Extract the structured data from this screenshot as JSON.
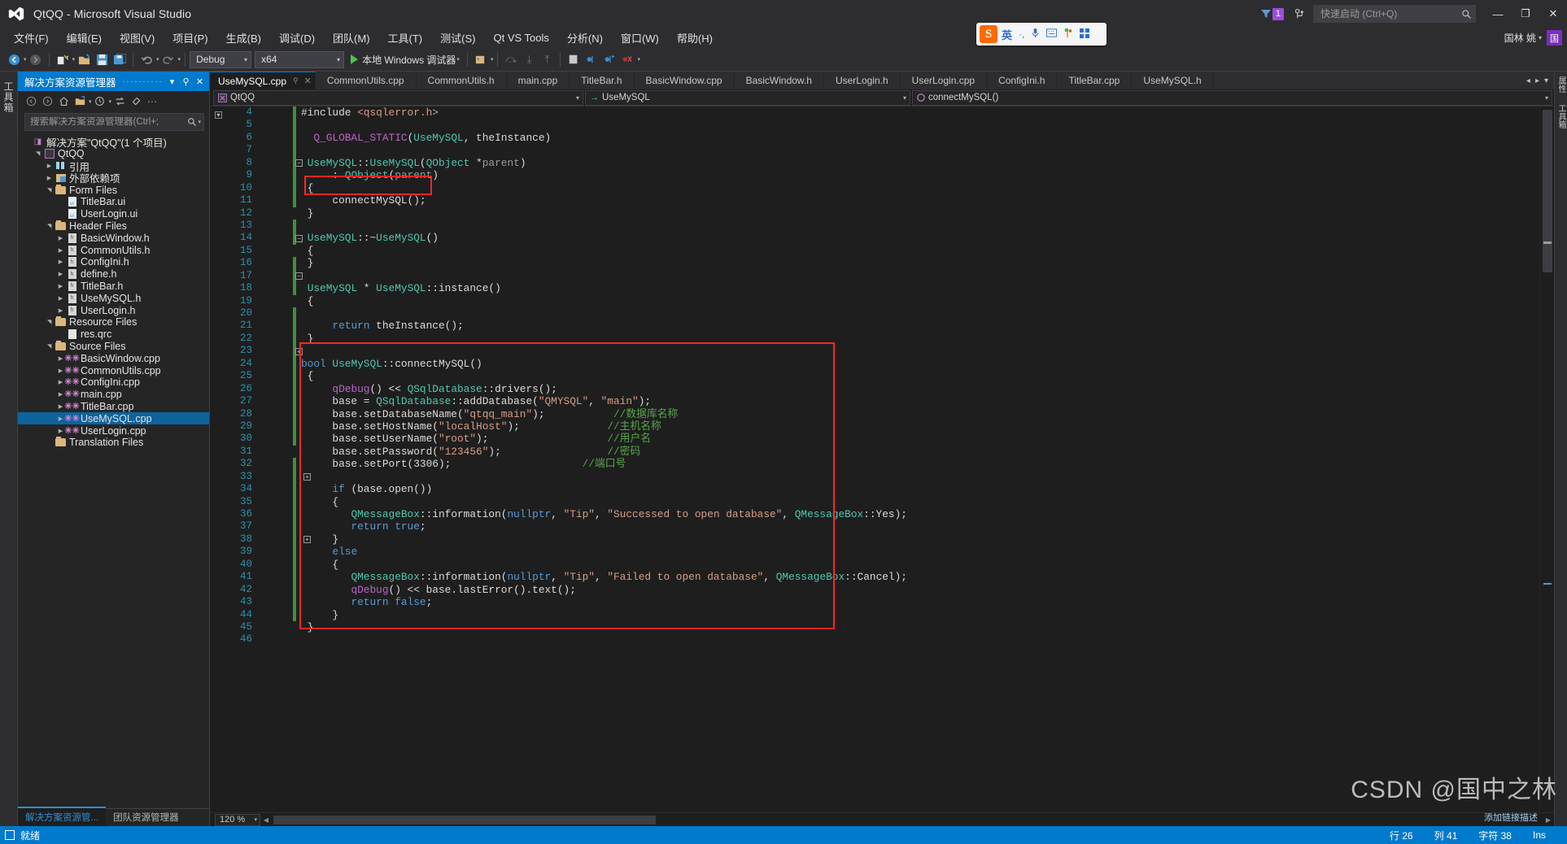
{
  "window": {
    "title": "QtQQ - Microsoft Visual Studio",
    "minimize": "—",
    "maximize": "❐",
    "close": "✕",
    "filter_badge": "1"
  },
  "quick_launch": {
    "placeholder": "快速启动 (Ctrl+Q)",
    "value": ""
  },
  "user": {
    "name": "国林 姚",
    "caret": "▾",
    "avatar_initial": "国"
  },
  "ime": {
    "logo": "S",
    "lang": "英",
    "punct": "·,",
    "mic": "🎤",
    "keyboard": "▦",
    "tools": "✿",
    "apps": "▩"
  },
  "menubar": [
    {
      "label": "文件(F)"
    },
    {
      "label": "编辑(E)"
    },
    {
      "label": "视图(V)"
    },
    {
      "label": "项目(P)"
    },
    {
      "label": "生成(B)"
    },
    {
      "label": "调试(D)"
    },
    {
      "label": "团队(M)"
    },
    {
      "label": "工具(T)"
    },
    {
      "label": "测试(S)"
    },
    {
      "label": "Qt VS Tools"
    },
    {
      "label": "分析(N)"
    },
    {
      "label": "窗口(W)"
    },
    {
      "label": "帮助(H)"
    }
  ],
  "toolbar": {
    "nav_back": "◉",
    "nav_forward": "◉",
    "new_item": "✹",
    "open": "↷",
    "save": "💾",
    "save_all": "🗐",
    "undo": "↶",
    "redo": "↷",
    "config_combo": {
      "value": "Debug",
      "caret": "▾"
    },
    "platform_combo": {
      "value": "x64",
      "caret": "▾"
    },
    "run_label": "本地 Windows 调试器",
    "run_caret": "▾"
  },
  "solution_explorer": {
    "title": "解决方案资源管理器",
    "dots": "··········",
    "dropdown": "▾",
    "pin": "⚲",
    "close": "✕",
    "toolbar": [
      "◀",
      "▶",
      "⌂",
      "🗀",
      "▾",
      "◔",
      "▾",
      "⇆",
      "⛭",
      "»"
    ],
    "search_placeholder": "搜索解决方案资源管理器(Ctrl+;",
    "search_value": "",
    "tabs": [
      {
        "label": "解决方案资源管...",
        "active": true
      },
      {
        "label": "团队资源管理器",
        "active": false
      }
    ],
    "tree": [
      {
        "label": "解决方案\"QtQQ\"(1 个项目)",
        "indent": 0,
        "arrow": "",
        "icon": "solution-icon",
        "selected": false
      },
      {
        "label": "QtQQ",
        "indent": 1,
        "arrow": "open",
        "icon": "project-icon",
        "selected": false
      },
      {
        "label": "引用",
        "indent": 2,
        "arrow": "closed",
        "icon": "reference-icon",
        "selected": false
      },
      {
        "label": "外部依赖项",
        "indent": 2,
        "arrow": "closed",
        "icon": "external-icon",
        "selected": false
      },
      {
        "label": "Form Files",
        "indent": 2,
        "arrow": "open",
        "icon": "folder-icon",
        "selected": false
      },
      {
        "label": "TitleBar.ui",
        "indent": 3,
        "arrow": "",
        "icon": "ui-file-icon",
        "selected": false
      },
      {
        "label": "UserLogin.ui",
        "indent": 3,
        "arrow": "",
        "icon": "ui-file-icon",
        "selected": false
      },
      {
        "label": "Header Files",
        "indent": 2,
        "arrow": "open",
        "icon": "folder-icon",
        "selected": false
      },
      {
        "label": "BasicWindow.h",
        "indent": 3,
        "arrow": "closed",
        "icon": "h-file-icon",
        "selected": false
      },
      {
        "label": "CommonUtils.h",
        "indent": 3,
        "arrow": "closed",
        "icon": "h-file-icon",
        "selected": false
      },
      {
        "label": "ConfigIni.h",
        "indent": 3,
        "arrow": "closed",
        "icon": "h-file-icon",
        "selected": false
      },
      {
        "label": "define.h",
        "indent": 3,
        "arrow": "closed",
        "icon": "h-file-icon",
        "selected": false
      },
      {
        "label": "TitleBar.h",
        "indent": 3,
        "arrow": "closed",
        "icon": "h-file-icon",
        "selected": false
      },
      {
        "label": "UseMySQL.h",
        "indent": 3,
        "arrow": "closed",
        "icon": "h-file-icon",
        "selected": false
      },
      {
        "label": "UserLogin.h",
        "indent": 3,
        "arrow": "closed",
        "icon": "h-file-icon",
        "selected": false
      },
      {
        "label": "Resource Files",
        "indent": 2,
        "arrow": "open",
        "icon": "folder-icon",
        "selected": false
      },
      {
        "label": "res.qrc",
        "indent": 3,
        "arrow": "",
        "icon": "qrc-file-icon",
        "selected": false
      },
      {
        "label": "Source Files",
        "indent": 2,
        "arrow": "open",
        "icon": "folder-icon",
        "selected": false
      },
      {
        "label": "BasicWindow.cpp",
        "indent": 3,
        "arrow": "closed",
        "icon": "cpp-file-icon",
        "selected": false
      },
      {
        "label": "CommonUtils.cpp",
        "indent": 3,
        "arrow": "closed",
        "icon": "cpp-file-icon",
        "selected": false
      },
      {
        "label": "ConfigIni.cpp",
        "indent": 3,
        "arrow": "closed",
        "icon": "cpp-file-icon",
        "selected": false
      },
      {
        "label": "main.cpp",
        "indent": 3,
        "arrow": "closed",
        "icon": "cpp-file-icon",
        "selected": false
      },
      {
        "label": "TitleBar.cpp",
        "indent": 3,
        "arrow": "closed",
        "icon": "cpp-file-icon",
        "selected": false
      },
      {
        "label": "UseMySQL.cpp",
        "indent": 3,
        "arrow": "closed",
        "icon": "cpp-file-icon",
        "selected": true
      },
      {
        "label": "UserLogin.cpp",
        "indent": 3,
        "arrow": "closed",
        "icon": "cpp-file-icon",
        "selected": false
      },
      {
        "label": "Translation Files",
        "indent": 2,
        "arrow": "",
        "icon": "folder-icon",
        "selected": false
      }
    ]
  },
  "editor": {
    "tabs": [
      {
        "label": "UseMySQL.cpp",
        "active": true,
        "pin": "⚲",
        "close": "✕"
      },
      {
        "label": "CommonUtils.cpp",
        "active": false
      },
      {
        "label": "CommonUtils.h",
        "active": false
      },
      {
        "label": "main.cpp",
        "active": false
      },
      {
        "label": "TitleBar.h",
        "active": false
      },
      {
        "label": "BasicWindow.cpp",
        "active": false
      },
      {
        "label": "BasicWindow.h",
        "active": false
      },
      {
        "label": "UserLogin.h",
        "active": false
      },
      {
        "label": "UserLogin.cpp",
        "active": false
      },
      {
        "label": "ConfigIni.h",
        "active": false
      },
      {
        "label": "TitleBar.cpp",
        "active": false
      },
      {
        "label": "UseMySQL.h",
        "active": false
      }
    ],
    "tab_overflow": {
      "left": "◂",
      "right": "▸",
      "list": "▾"
    },
    "navbar": {
      "project": "QtQQ",
      "class": "UseMySQL",
      "member": "connectMySQL()",
      "caret": "▾"
    },
    "zoom": "120 %",
    "first_line": 4,
    "lines": [
      {
        "n": 4,
        "tokens": [
          {
            "t": "#include ",
            "c": "pl"
          },
          {
            "t": "<qsqlerror.h>",
            "c": "st"
          }
        ]
      },
      {
        "n": 5,
        "tokens": []
      },
      {
        "n": 6,
        "tokens": [
          {
            "t": "  ",
            "c": "pl"
          },
          {
            "t": "Q_GLOBAL_STATIC",
            "c": "mc"
          },
          {
            "t": "(",
            "c": "pl"
          },
          {
            "t": "UseMySQL",
            "c": "ty"
          },
          {
            "t": ", theInstance)",
            "c": "pl"
          }
        ]
      },
      {
        "n": 7,
        "tokens": []
      },
      {
        "n": 8,
        "tokens": [
          {
            "t": " ",
            "c": "pl"
          },
          {
            "t": "UseMySQL",
            "c": "ty"
          },
          {
            "t": "::",
            "c": "pl"
          },
          {
            "t": "UseMySQL",
            "c": "ty"
          },
          {
            "t": "(",
            "c": "pl"
          },
          {
            "t": "QObject",
            "c": "ty"
          },
          {
            "t": " *",
            "c": "pl"
          },
          {
            "t": "parent",
            "c": "pr"
          },
          {
            "t": ")",
            "c": "pl"
          }
        ]
      },
      {
        "n": 9,
        "tokens": [
          {
            "t": "     : ",
            "c": "pl"
          },
          {
            "t": "QObject",
            "c": "ty"
          },
          {
            "t": "(",
            "c": "pl"
          },
          {
            "t": "parent",
            "c": "pr"
          },
          {
            "t": ")",
            "c": "pl"
          }
        ]
      },
      {
        "n": 10,
        "tokens": [
          {
            "t": " {",
            "c": "pl"
          }
        ]
      },
      {
        "n": 11,
        "tokens": [
          {
            "t": "     connectMySQL();",
            "c": "pl"
          }
        ]
      },
      {
        "n": 12,
        "tokens": [
          {
            "t": " }",
            "c": "pl"
          }
        ]
      },
      {
        "n": 13,
        "tokens": []
      },
      {
        "n": 14,
        "tokens": [
          {
            "t": " ",
            "c": "pl"
          },
          {
            "t": "UseMySQL",
            "c": "ty"
          },
          {
            "t": "::~",
            "c": "pl"
          },
          {
            "t": "UseMySQL",
            "c": "ty"
          },
          {
            "t": "()",
            "c": "pl"
          }
        ]
      },
      {
        "n": 15,
        "tokens": [
          {
            "t": " {",
            "c": "pl"
          }
        ]
      },
      {
        "n": 16,
        "tokens": [
          {
            "t": " }",
            "c": "pl"
          }
        ]
      },
      {
        "n": 17,
        "tokens": []
      },
      {
        "n": 18,
        "tokens": [
          {
            "t": " ",
            "c": "pl"
          },
          {
            "t": "UseMySQL",
            "c": "ty"
          },
          {
            "t": " * ",
            "c": "pl"
          },
          {
            "t": "UseMySQL",
            "c": "ty"
          },
          {
            "t": "::",
            "c": "pl"
          },
          {
            "t": "instance",
            "c": "pl"
          },
          {
            "t": "()",
            "c": "pl"
          }
        ]
      },
      {
        "n": 19,
        "tokens": [
          {
            "t": " {",
            "c": "pl"
          }
        ]
      },
      {
        "n": 20,
        "tokens": []
      },
      {
        "n": 21,
        "tokens": [
          {
            "t": "     ",
            "c": "pl"
          },
          {
            "t": "return",
            "c": "k"
          },
          {
            "t": " theInstance();",
            "c": "pl"
          }
        ]
      },
      {
        "n": 22,
        "tokens": [
          {
            "t": " }",
            "c": "pl"
          }
        ]
      },
      {
        "n": 23,
        "tokens": []
      },
      {
        "n": 24,
        "tokens": [
          {
            "t": "bool",
            "c": "k"
          },
          {
            "t": " ",
            "c": "pl"
          },
          {
            "t": "UseMySQL",
            "c": "ty"
          },
          {
            "t": "::",
            "c": "pl"
          },
          {
            "t": "connectMySQL",
            "c": "pl"
          },
          {
            "t": "()",
            "c": "pl"
          }
        ]
      },
      {
        "n": 25,
        "tokens": [
          {
            "t": " {",
            "c": "pl"
          }
        ]
      },
      {
        "n": 26,
        "tokens": [
          {
            "t": "     ",
            "c": "pl"
          },
          {
            "t": "qDebug",
            "c": "mc"
          },
          {
            "t": "() << ",
            "c": "pl"
          },
          {
            "t": "QSqlDatabase",
            "c": "ty"
          },
          {
            "t": "::drivers();",
            "c": "pl"
          }
        ]
      },
      {
        "n": 27,
        "tokens": [
          {
            "t": "     base = ",
            "c": "pl"
          },
          {
            "t": "QSqlDatabase",
            "c": "ty"
          },
          {
            "t": "::addDatabase(",
            "c": "pl"
          },
          {
            "t": "\"QMYSQL\"",
            "c": "st"
          },
          {
            "t": ", ",
            "c": "pl"
          },
          {
            "t": "\"main\"",
            "c": "st"
          },
          {
            "t": ");",
            "c": "pl"
          }
        ]
      },
      {
        "n": 28,
        "tokens": [
          {
            "t": "     base.setDatabaseName(",
            "c": "pl"
          },
          {
            "t": "\"qtqq_main\"",
            "c": "st"
          },
          {
            "t": ");           ",
            "c": "pl"
          },
          {
            "t": "//数据库名称",
            "c": "cm"
          }
        ]
      },
      {
        "n": 29,
        "tokens": [
          {
            "t": "     base.setHostName(",
            "c": "pl"
          },
          {
            "t": "\"localHost\"",
            "c": "st"
          },
          {
            "t": ");              ",
            "c": "pl"
          },
          {
            "t": "//主机名称",
            "c": "cm"
          }
        ]
      },
      {
        "n": 30,
        "tokens": [
          {
            "t": "     base.setUserName(",
            "c": "pl"
          },
          {
            "t": "\"root\"",
            "c": "st"
          },
          {
            "t": ");                   ",
            "c": "pl"
          },
          {
            "t": "//用户名",
            "c": "cm"
          }
        ]
      },
      {
        "n": 31,
        "tokens": [
          {
            "t": "     base.setPassword(",
            "c": "pl"
          },
          {
            "t": "\"123456\"",
            "c": "st"
          },
          {
            "t": ");                 ",
            "c": "pl"
          },
          {
            "t": "//密码",
            "c": "cm"
          }
        ]
      },
      {
        "n": 32,
        "tokens": [
          {
            "t": "     base.setPort(3306);                     ",
            "c": "pl"
          },
          {
            "t": "//端口号",
            "c": "cm"
          }
        ]
      },
      {
        "n": 33,
        "tokens": []
      },
      {
        "n": 34,
        "tokens": [
          {
            "t": "     ",
            "c": "pl"
          },
          {
            "t": "if",
            "c": "k"
          },
          {
            "t": " (base.open())",
            "c": "pl"
          }
        ]
      },
      {
        "n": 35,
        "tokens": [
          {
            "t": "     {",
            "c": "pl"
          }
        ]
      },
      {
        "n": 36,
        "tokens": [
          {
            "t": "        ",
            "c": "pl"
          },
          {
            "t": "QMessageBox",
            "c": "ty"
          },
          {
            "t": "::information(",
            "c": "pl"
          },
          {
            "t": "nullptr",
            "c": "k"
          },
          {
            "t": ", ",
            "c": "pl"
          },
          {
            "t": "\"Tip\"",
            "c": "st"
          },
          {
            "t": ", ",
            "c": "pl"
          },
          {
            "t": "\"Successed to open database\"",
            "c": "st"
          },
          {
            "t": ", ",
            "c": "pl"
          },
          {
            "t": "QMessageBox",
            "c": "ty"
          },
          {
            "t": "::Yes);",
            "c": "pl"
          }
        ]
      },
      {
        "n": 37,
        "tokens": [
          {
            "t": "        ",
            "c": "pl"
          },
          {
            "t": "return",
            "c": "k"
          },
          {
            "t": " ",
            "c": "pl"
          },
          {
            "t": "true",
            "c": "k"
          },
          {
            "t": ";",
            "c": "pl"
          }
        ]
      },
      {
        "n": 38,
        "tokens": [
          {
            "t": "     }",
            "c": "pl"
          }
        ]
      },
      {
        "n": 39,
        "tokens": [
          {
            "t": "     ",
            "c": "pl"
          },
          {
            "t": "else",
            "c": "k"
          }
        ]
      },
      {
        "n": 40,
        "tokens": [
          {
            "t": "     {",
            "c": "pl"
          }
        ]
      },
      {
        "n": 41,
        "tokens": [
          {
            "t": "        ",
            "c": "pl"
          },
          {
            "t": "QMessageBox",
            "c": "ty"
          },
          {
            "t": "::information(",
            "c": "pl"
          },
          {
            "t": "nullptr",
            "c": "k"
          },
          {
            "t": ", ",
            "c": "pl"
          },
          {
            "t": "\"Tip\"",
            "c": "st"
          },
          {
            "t": ", ",
            "c": "pl"
          },
          {
            "t": "\"Failed to open database\"",
            "c": "st"
          },
          {
            "t": ", ",
            "c": "pl"
          },
          {
            "t": "QMessageBox",
            "c": "ty"
          },
          {
            "t": "::Cancel);",
            "c": "pl"
          }
        ]
      },
      {
        "n": 42,
        "tokens": [
          {
            "t": "        ",
            "c": "pl"
          },
          {
            "t": "qDebug",
            "c": "mc"
          },
          {
            "t": "() << base.lastError().text();",
            "c": "pl"
          }
        ]
      },
      {
        "n": 43,
        "tokens": [
          {
            "t": "        ",
            "c": "pl"
          },
          {
            "t": "return",
            "c": "k"
          },
          {
            "t": " ",
            "c": "pl"
          },
          {
            "t": "false",
            "c": "k"
          },
          {
            "t": ";",
            "c": "pl"
          }
        ]
      },
      {
        "n": 44,
        "tokens": [
          {
            "t": "     }",
            "c": "pl"
          }
        ]
      },
      {
        "n": 45,
        "tokens": [
          {
            "t": " }",
            "c": "pl"
          }
        ]
      },
      {
        "n": 46,
        "tokens": []
      }
    ]
  },
  "right_strip": [
    "属性",
    "工具箱"
  ],
  "statusbar": {
    "ready": "就绪",
    "row_label": "行 26",
    "col_label": "列 41",
    "char_label": "字符 38",
    "ins_label": "Ins"
  },
  "watermark": {
    "main": "CSDN @国中之林",
    "sub": "添加链接描述"
  },
  "colors": {
    "accent": "#007acc",
    "highlight_box": "#ff2424",
    "selection": "#0e639c",
    "keyword": "#569cd6",
    "type": "#4ec9b0",
    "string": "#d69d85",
    "comment": "#57a64a",
    "macro": "#bd63c5",
    "linenum": "#2b91af"
  }
}
